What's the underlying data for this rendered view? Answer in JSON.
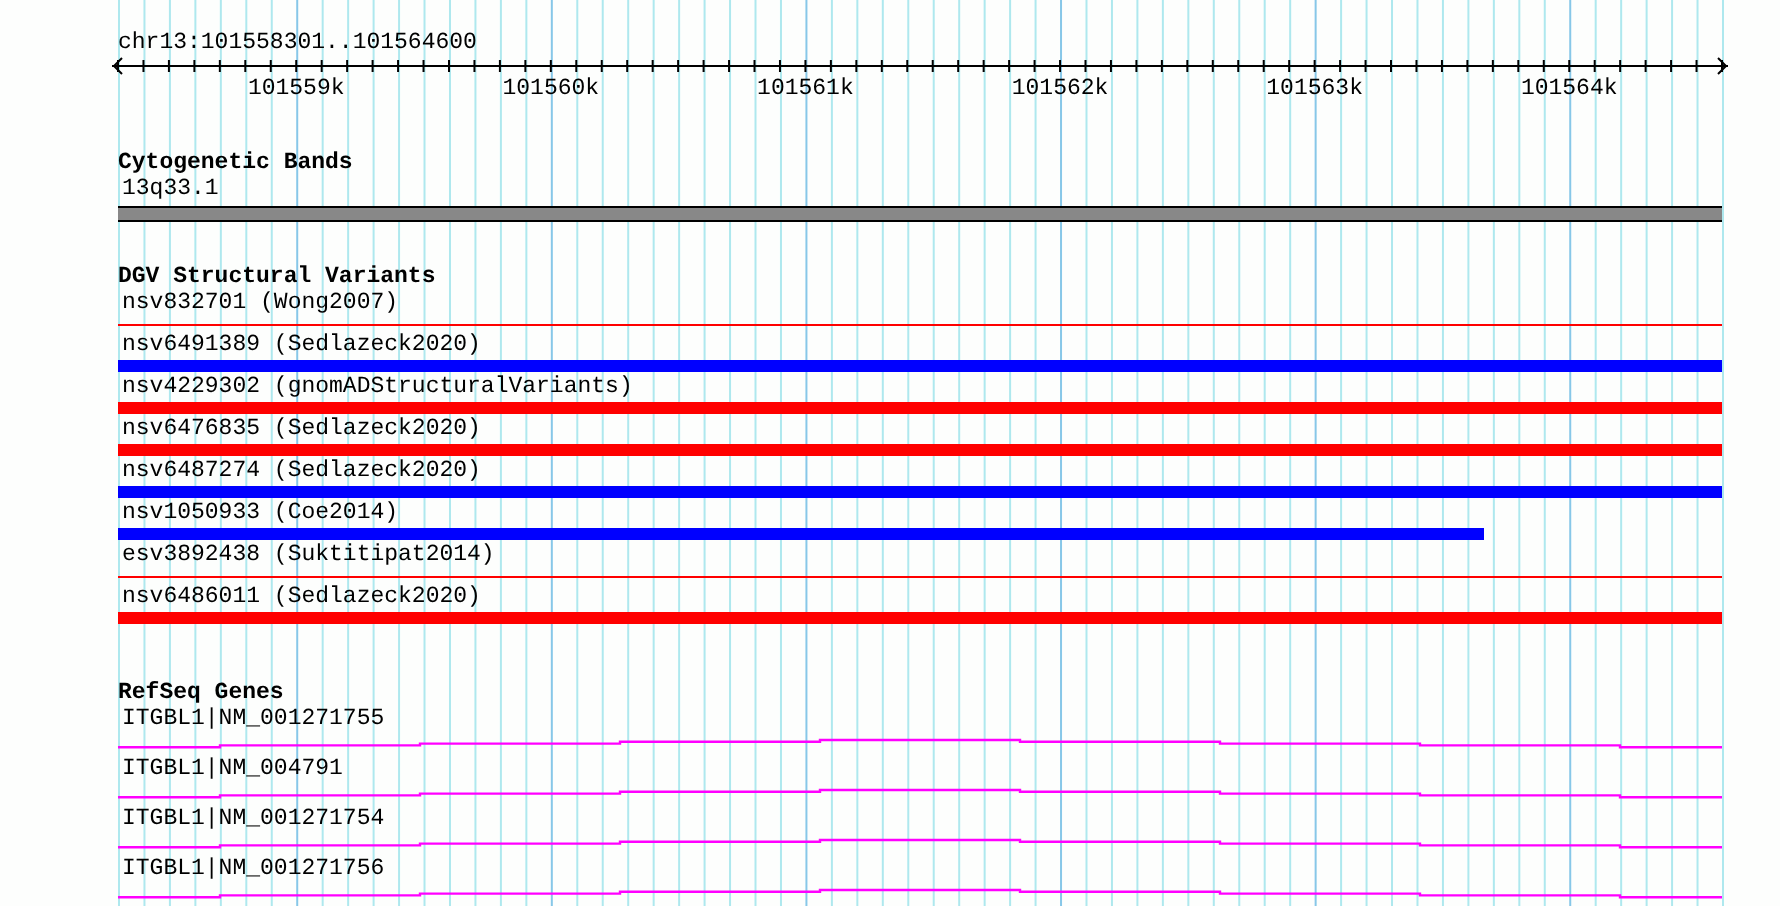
{
  "ruler": {
    "range": "chr13:101558301..101564600",
    "tick_labels": [
      "101559k",
      "101560k",
      "101561k",
      "101562k",
      "101563k",
      "101564k"
    ]
  },
  "cytogenetic_bands": {
    "title": "Cytogenetic Bands",
    "band": "13q33.1"
  },
  "dgv_structural_variants": {
    "title": "DGV Structural Variants",
    "variants": [
      {
        "label": "nsv832701 (Wong2007)",
        "kind": "thin",
        "color": "#ff0000",
        "partial": false
      },
      {
        "label": "nsv6491389 (Sedlazeck2020)",
        "kind": "thick",
        "color": "#0000ff",
        "partial": false
      },
      {
        "label": "nsv4229302 (gnomADStructuralVariants)",
        "kind": "thick",
        "color": "#ff0000",
        "partial": false
      },
      {
        "label": "nsv6476835 (Sedlazeck2020)",
        "kind": "thick",
        "color": "#ff0000",
        "partial": false
      },
      {
        "label": "nsv6487274 (Sedlazeck2020)",
        "kind": "thick",
        "color": "#0000ff",
        "partial": false
      },
      {
        "label": "nsv1050933 (Coe2014)",
        "kind": "thick",
        "color": "#0000ff",
        "partial": true
      },
      {
        "label": "esv3892438 (Suktitipat2014)",
        "kind": "thin",
        "color": "#ff0000",
        "partial": false
      },
      {
        "label": "nsv6486011 (Sedlazeck2020)",
        "kind": "thick",
        "color": "#ff0000",
        "partial": false
      }
    ]
  },
  "refseq_genes": {
    "title": "RefSeq Genes",
    "genes": [
      {
        "label": "ITGBL1|NM_001271755"
      },
      {
        "label": "ITGBL1|NM_004791"
      },
      {
        "label": "ITGBL1|NM_001271754"
      },
      {
        "label": "ITGBL1|NM_001271756"
      }
    ]
  }
}
